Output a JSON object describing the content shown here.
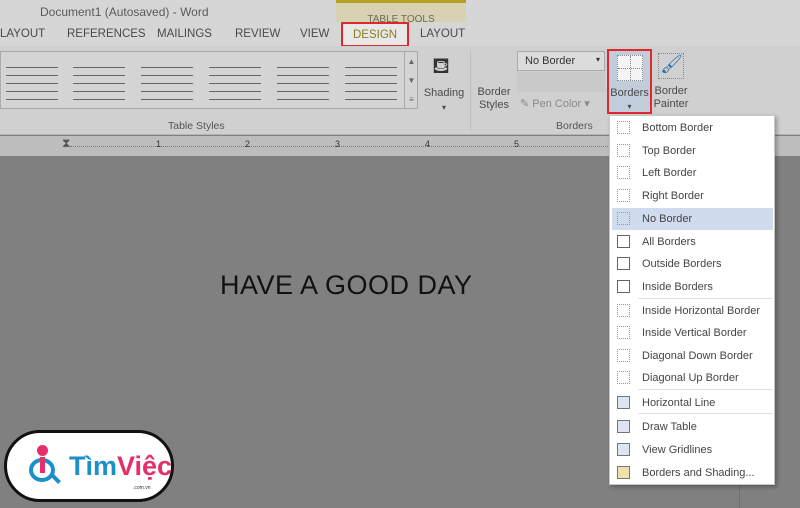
{
  "title": "Document1 (Autosaved) - Word",
  "context_tab_group": "TABLE TOOLS",
  "tabs": [
    {
      "label": "LAYOUT"
    },
    {
      "label": "REFERENCES"
    },
    {
      "label": "MAILINGS"
    },
    {
      "label": "REVIEW"
    },
    {
      "label": "VIEW"
    },
    {
      "label": "DESIGN",
      "active": true
    },
    {
      "label": "LAYOUT"
    }
  ],
  "ribbon": {
    "table_styles_group": "Table Styles",
    "shading": "Shading",
    "border_styles": "Border Styles",
    "border_select": "No Border",
    "pen_color": "Pen Color",
    "borders_btn": "Borders",
    "border_painter": "Border Painter",
    "borders_group": "Borders"
  },
  "ruler": [
    "1",
    "2",
    "3",
    "4",
    "5"
  ],
  "document": {
    "text": "HAVE A GOOD DAY"
  },
  "menu": {
    "items": [
      {
        "label": "Bottom Border",
        "icon": "bottom-border-icon"
      },
      {
        "label": "Top Border",
        "icon": "top-border-icon"
      },
      {
        "label": "Left Border",
        "icon": "left-border-icon"
      },
      {
        "label": "Right Border",
        "icon": "right-border-icon"
      },
      {
        "label": "No Border",
        "icon": "no-border-icon",
        "highlighted": true
      },
      {
        "label": "All Borders",
        "icon": "all-borders-icon"
      },
      {
        "label": "Outside Borders",
        "icon": "outside-borders-icon"
      },
      {
        "label": "Inside Borders",
        "icon": "inside-borders-icon"
      },
      {
        "label": "Inside Horizontal Border",
        "icon": "inside-horizontal-border-icon"
      },
      {
        "label": "Inside Vertical Border",
        "icon": "inside-vertical-border-icon"
      },
      {
        "label": "Diagonal Down Border",
        "icon": "diagonal-down-border-icon"
      },
      {
        "label": "Diagonal Up Border",
        "icon": "diagonal-up-border-icon"
      },
      {
        "label": "Horizontal Line",
        "icon": "horizontal-line-icon"
      },
      {
        "label": "Draw Table",
        "icon": "draw-table-icon"
      },
      {
        "label": "View Gridlines",
        "icon": "view-gridlines-icon"
      },
      {
        "label": "Borders and Shading...",
        "icon": "borders-shading-icon"
      }
    ]
  },
  "logo": {
    "brand_a": "Tìm",
    "brand_b": "Việc",
    "sub": ".com.vn"
  },
  "colors": {
    "highlight_box": "#e0282a",
    "menu_hover": "#d0dced",
    "brand_blue": "#1b8fc9",
    "brand_pink": "#e62f6a"
  }
}
